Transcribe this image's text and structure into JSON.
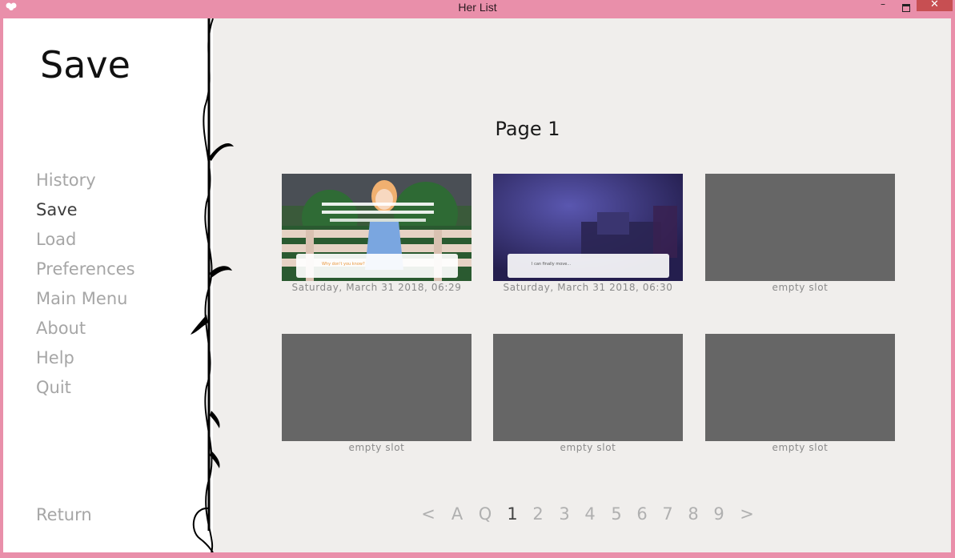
{
  "window": {
    "title": "Her List",
    "minimize": "–",
    "close": "✕"
  },
  "sidebar": {
    "title": "Save",
    "items": [
      {
        "label": "History"
      },
      {
        "label": "Save"
      },
      {
        "label": "Load"
      },
      {
        "label": "Preferences"
      },
      {
        "label": "Main Menu"
      },
      {
        "label": "About"
      },
      {
        "label": "Help"
      },
      {
        "label": "Quit"
      }
    ],
    "return_label": "Return"
  },
  "page": {
    "title": "Page 1"
  },
  "slots": [
    {
      "label": "Saturday, March 31 2018, 06:29",
      "dialogue": "Why don't you know?"
    },
    {
      "label": "Saturday, March 31 2018, 06:30",
      "dialogue": "I can finally move..."
    },
    {
      "label": "empty slot"
    },
    {
      "label": "empty slot"
    },
    {
      "label": "empty slot"
    },
    {
      "label": "empty slot"
    }
  ],
  "pagination": [
    "<",
    "A",
    "Q",
    "1",
    "2",
    "3",
    "4",
    "5",
    "6",
    "7",
    "8",
    "9",
    ">"
  ],
  "colors": {
    "titlebar": "#e98faa",
    "close": "#c74f52",
    "empty_slot": "#666666",
    "nav_inactive": "#a6a6a6",
    "nav_active": "#3e3e3e"
  }
}
